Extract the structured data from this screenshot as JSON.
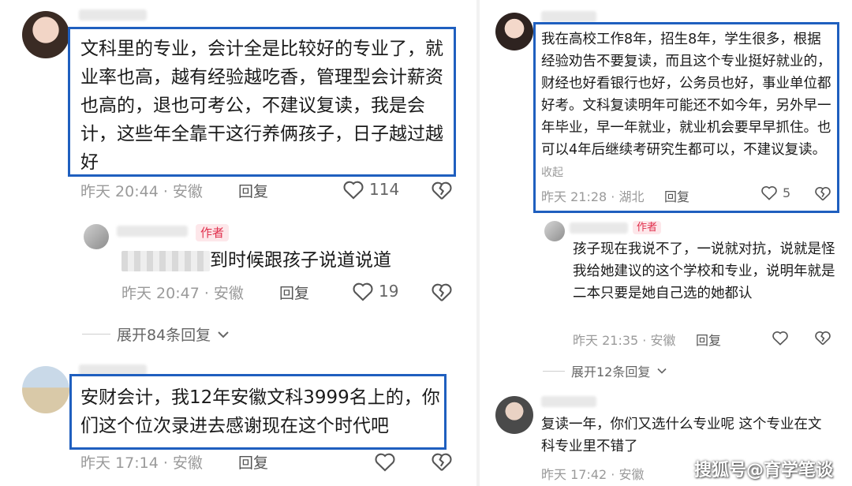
{
  "left": {
    "comment1": {
      "text": "文科里的专业，会计全是比较好的专业了，就业率也高，越有经验越吃香，管理型会计薪资也高的，退也可考公，不建议复读，我是会计，这些年全靠干这行养俩孩子，日子越过越好",
      "time": "昨天 20:44",
      "location": "安徽",
      "reply": "回复",
      "likes": "114"
    },
    "author_reply": {
      "badge": "作者",
      "text_visible": "到时候跟孩子说道说道",
      "time": "昨天 20:47",
      "location": "安徽",
      "reply": "回复",
      "likes": "19"
    },
    "expand1": "展开84条回复",
    "comment2": {
      "text": "安财会计，我12年安徽文科3999名上的，你们这个位次录进去感谢现在这个时代吧",
      "time": "昨天 17:14",
      "location": "安徽",
      "reply": "回复"
    }
  },
  "right": {
    "comment1": {
      "text": "我在高校工作8年，招生8年，学生很多，根据经验劝告不要复读，而且这个专业挺好就业的，财经也好看银行也好，公务员也好，事业单位都好考。文科复读明年可能还不如今年，另外早一年毕业，早一年就业，就业机会要早早抓住。也可以4年后继续考研究生都可以，不建议复读。",
      "fold": "收起",
      "time": "昨天 21:28",
      "location": "湖北",
      "reply": "回复",
      "likes": "5"
    },
    "author_reply": {
      "badge": "作者",
      "text": "孩子现在我说不了，一说就对抗，说就是怪我给她建议的这个学校和专业，说明年就是二本只要是她自己选的她都认",
      "time": "昨天 21:35",
      "location": "安徽",
      "reply": "回复"
    },
    "expand1": "展开12条回复",
    "comment2": {
      "text": "复读一年，你们又选什么专业呢 这个专业在文科专业里不错了",
      "time": "昨天 17:42",
      "location": "安徽"
    }
  },
  "watermark": "搜狐号@育学笔谈",
  "colors": {
    "highlight": "#1f5fbf",
    "badge_bg": "#fde7ea",
    "badge_text": "#e0304d",
    "meta": "#9a9a9a"
  },
  "icons": [
    "heart-icon",
    "heart-broken-icon",
    "chevron-down-icon"
  ]
}
